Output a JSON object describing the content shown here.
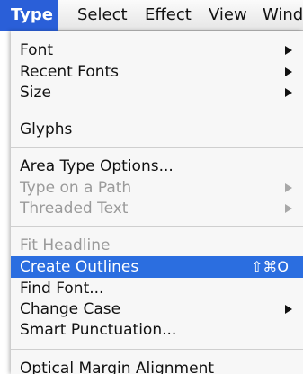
{
  "menubar": {
    "items": [
      {
        "label": "Type"
      },
      {
        "label": "Select"
      },
      {
        "label": "Effect"
      },
      {
        "label": "View"
      },
      {
        "label": "Wind"
      }
    ]
  },
  "menu": {
    "items": [
      {
        "label": "Font",
        "submenu": true
      },
      {
        "label": "Recent Fonts",
        "submenu": true
      },
      {
        "label": "Size",
        "submenu": true
      },
      {
        "label": "Glyphs"
      },
      {
        "label": "Area Type Options..."
      },
      {
        "label": "Type on a Path",
        "disabled": true,
        "submenu": true
      },
      {
        "label": "Threaded Text",
        "disabled": true,
        "submenu": true
      },
      {
        "label": "Fit Headline",
        "disabled": true
      },
      {
        "label": "Create Outlines",
        "selected": true,
        "shortcut": "⇧⌘O"
      },
      {
        "label": "Find Font..."
      },
      {
        "label": "Change Case",
        "submenu": true
      },
      {
        "label": "Smart Punctuation..."
      },
      {
        "label": "Optical Margin Alignment"
      }
    ]
  },
  "colors": {
    "active_menu_title": "#2a5fd8",
    "highlight": "#2b6ee0",
    "disabled_text": "#9a9a9a"
  }
}
